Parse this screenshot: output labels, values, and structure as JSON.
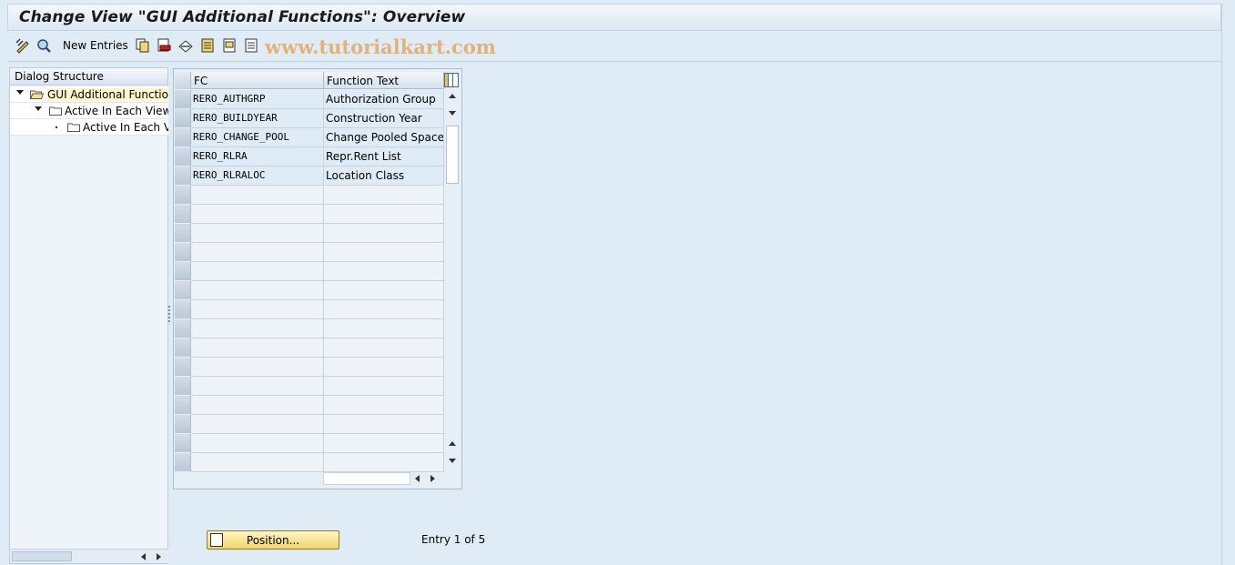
{
  "window": {
    "title": "Change View \"GUI Additional Functions\": Overview"
  },
  "toolbar": {
    "new_entries_label": "New Entries",
    "icons": [
      "display-change-icon",
      "find-icon",
      "copy-icon",
      "delete-icon",
      "undo-icon",
      "select-all-icon",
      "select-block-icon",
      "deselect-all-icon"
    ]
  },
  "watermark": "www.tutorialkart.com",
  "dialog_structure": {
    "header": "Dialog Structure",
    "items": [
      {
        "label": "GUI Additional Functions",
        "level": 0,
        "expanded": true,
        "selected": true
      },
      {
        "label": "Active In Each View",
        "level": 1,
        "expanded": true,
        "selected": false
      },
      {
        "label": "Active In Each Vi",
        "level": 2,
        "expanded": false,
        "selected": false
      }
    ]
  },
  "table": {
    "columns": [
      "FC",
      "Function Text"
    ],
    "rows": [
      [
        "RERO_AUTHGRP",
        "Authorization Group"
      ],
      [
        "RERO_BUILDYEAR",
        "Construction Year"
      ],
      [
        "RERO_CHANGE_POOL",
        "Change Pooled Space"
      ],
      [
        "RERO_RLRA",
        "Repr.Rent List"
      ],
      [
        "RERO_RLRALOC",
        "Location Class"
      ]
    ],
    "empty_rows": 15
  },
  "footer": {
    "position_button_label": "Position...",
    "entry_info": "Entry 1 of 5"
  }
}
